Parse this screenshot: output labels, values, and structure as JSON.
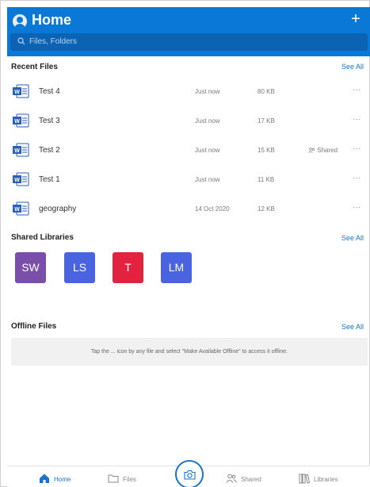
{
  "header": {
    "title": "Home",
    "add_label": "+",
    "search_placeholder": "Files, Folders"
  },
  "recent": {
    "title": "Recent Files",
    "see_all": "See All",
    "files": [
      {
        "name": "Test 4",
        "time": "Just now",
        "size": "80 KB",
        "shared": "",
        "more": "···"
      },
      {
        "name": "Test 3",
        "time": "Just now",
        "size": "17 KB",
        "shared": "",
        "more": "···"
      },
      {
        "name": "Test 2",
        "time": "Just now",
        "size": "15 KB",
        "shared": "Shared",
        "more": "···"
      },
      {
        "name": "Test 1",
        "time": "Just now",
        "size": "11 KB",
        "shared": "",
        "more": "···"
      },
      {
        "name": "geography",
        "time": "14 Oct 2020",
        "size": "12 KB",
        "shared": "",
        "more": "···"
      }
    ]
  },
  "libraries": {
    "title": "Shared Libraries",
    "see_all": "See All",
    "items": [
      {
        "initials": "SW",
        "color": "#7a4fa9"
      },
      {
        "initials": "LS",
        "color": "#4a63e0"
      },
      {
        "initials": "T",
        "color": "#e2223f"
      },
      {
        "initials": "LM",
        "color": "#4a63e0"
      }
    ]
  },
  "offline": {
    "title": "Offline Files",
    "see_all": "See All",
    "message": "Tap the ... icon by any file and select \"Make Available Offline\" to access it offline."
  },
  "tabs": [
    {
      "label": "Home",
      "icon": "home-icon",
      "active": true
    },
    {
      "label": "Files",
      "icon": "folder-icon",
      "active": false
    },
    {
      "label": "Shared",
      "icon": "people-icon",
      "active": false
    },
    {
      "label": "Libraries",
      "icon": "library-icon",
      "active": false
    }
  ],
  "colors": {
    "brand": "#0a78d7",
    "link": "#1a73c9"
  }
}
